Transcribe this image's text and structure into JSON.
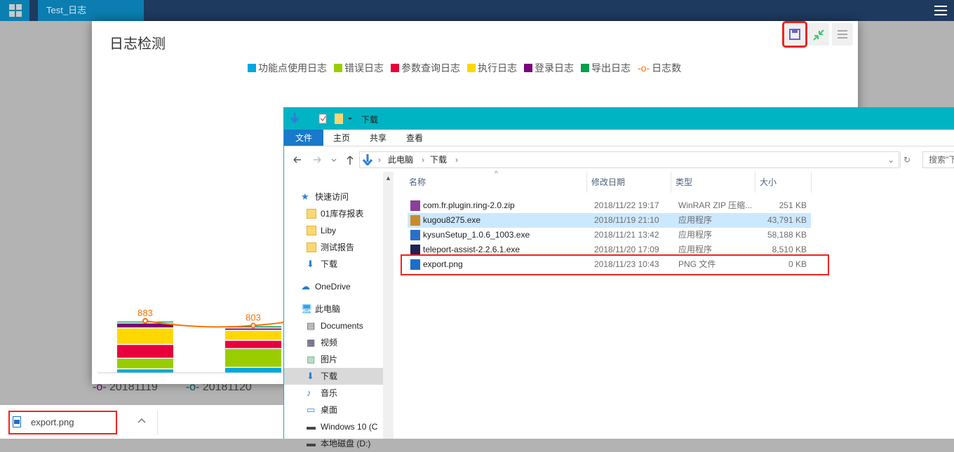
{
  "app": {
    "tab_title": "Test_日志"
  },
  "chart_panel": {
    "title": "日志检测",
    "toolbar": [
      "save-icon",
      "restore-icon",
      "menu-icon"
    ]
  },
  "chart_data": {
    "type": "bar",
    "title": "日志检测",
    "stacked": true,
    "categories": [
      "20181119",
      "20181120"
    ],
    "legend": [
      "功能点使用日志",
      "错误日志",
      "参数查询日志",
      "执行日志",
      "登录日志",
      "导出日志",
      "日志数"
    ],
    "colors": [
      "#00a7e1",
      "#9acd00",
      "#e8003c",
      "#ffd800",
      "#7b007b",
      "#00a050",
      "#ff7000"
    ],
    "series": [
      {
        "name": "功能点使用日志",
        "values": [
          70,
          95
        ]
      },
      {
        "name": "错误日志",
        "values": [
          180,
          320
        ]
      },
      {
        "name": "参数查询日志",
        "values": [
          235,
          140
        ]
      },
      {
        "name": "执行日志",
        "values": [
          280,
          170
        ]
      },
      {
        "name": "登录日志",
        "values": [
          85,
          40
        ]
      },
      {
        "name": "导出日志",
        "values": [
          33,
          38
        ]
      }
    ],
    "line": {
      "name": "日志数",
      "values": [
        883,
        803
      ],
      "labels": [
        "883",
        "803"
      ]
    }
  },
  "below_legend": [
    "20181119",
    "20181120"
  ],
  "download": {
    "file": "export.png"
  },
  "explorer": {
    "title": "下载",
    "ribbon": [
      "文件",
      "主页",
      "共享",
      "查看"
    ],
    "path": [
      "此电脑",
      "下载"
    ],
    "search": "搜索\"下",
    "nav": [
      {
        "label": "快速访问",
        "type": "star"
      },
      {
        "label": "01库存报表",
        "type": "folder"
      },
      {
        "label": "Liby",
        "type": "folder"
      },
      {
        "label": "测试报告",
        "type": "folder"
      },
      {
        "label": "下载",
        "type": "down"
      },
      {
        "label": "OneDrive",
        "type": "cloud"
      },
      {
        "label": "此电脑",
        "type": "pc"
      },
      {
        "label": "Documents",
        "type": "doc"
      },
      {
        "label": "视频",
        "type": "video"
      },
      {
        "label": "图片",
        "type": "pic"
      },
      {
        "label": "下载",
        "type": "down"
      },
      {
        "label": "音乐",
        "type": "music"
      },
      {
        "label": "桌面",
        "type": "desk"
      },
      {
        "label": "Windows 10 (C",
        "type": "drive"
      },
      {
        "label": "本地磁盘 (D:)",
        "type": "drive"
      }
    ],
    "columns": [
      "名称",
      "修改日期",
      "类型",
      "大小"
    ],
    "files": [
      {
        "name": "com.fr.plugin.ring-2.0.zip",
        "date": "2018/11/22 19:17",
        "type": "WinRAR ZIP 压缩...",
        "size": "251 KB"
      },
      {
        "name": "kugou8275.exe",
        "date": "2018/11/19 21:10",
        "type": "应用程序",
        "size": "43,791 KB"
      },
      {
        "name": "kysunSetup_1.0.6_1003.exe",
        "date": "2018/11/21 13:42",
        "type": "应用程序",
        "size": "58,188 KB"
      },
      {
        "name": "teleport-assist-2.2.6.1.exe",
        "date": "2018/11/20 17:09",
        "type": "应用程序",
        "size": "8,510 KB"
      },
      {
        "name": "export.png",
        "date": "2018/11/23 10:43",
        "type": "PNG 文件",
        "size": "0 KB"
      }
    ]
  }
}
